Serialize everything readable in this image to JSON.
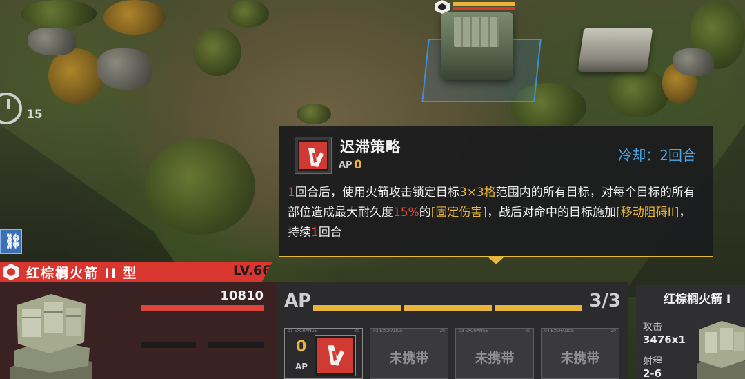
{
  "battlefield": {
    "turn_counter": "15"
  },
  "tooltip": {
    "skill_name": "迟滞策略",
    "ap_label": "AP",
    "ap_cost": "0",
    "cooldown_label": "冷却：",
    "cooldown_value": "2回合",
    "description": {
      "p1": "1",
      "p2": "回合后，使用火箭攻击锁定目标",
      "p3": "3×3格",
      "p4": "范围内的所有目标，对每个目标的所有部位造成最大耐久度",
      "p5": "15%",
      "p6": "的",
      "p7": "[固定伤害]",
      "p8": "，战后对命中的目标施加",
      "p9": "[移动阻碍II]",
      "p10": "，持续",
      "p11": "1",
      "p12": "回合"
    }
  },
  "unit": {
    "name": "红棕榈火箭 II 型",
    "level": "LV.66",
    "hp": "10810",
    "hp_fraction": 1.0
  },
  "ap_panel": {
    "label": "AP",
    "current": 3,
    "max": 3,
    "count_text": "3/3",
    "slots": [
      {
        "ap_cost": "0",
        "ap_label": "AP",
        "tag_left": "01 EXCHANGE",
        "tag_right": "20"
      },
      {
        "label": "未携带",
        "tag_left": "02 EXCHANGE",
        "tag_right": "20"
      },
      {
        "label": "未携带",
        "tag_left": "03 EXCHANGE",
        "tag_right": "20"
      },
      {
        "label": "未携带",
        "tag_left": "04 EXCHANGE",
        "tag_right": "20"
      }
    ]
  },
  "target": {
    "name": "红棕榈火箭 I",
    "attack_label": "攻击",
    "attack_value": "3476x1",
    "range_label": "射程",
    "range_value": "2-6"
  },
  "colors": {
    "accent_red": "#d9362f",
    "accent_yellow": "#e9b43a",
    "cooldown_blue": "#4aa8e8"
  }
}
